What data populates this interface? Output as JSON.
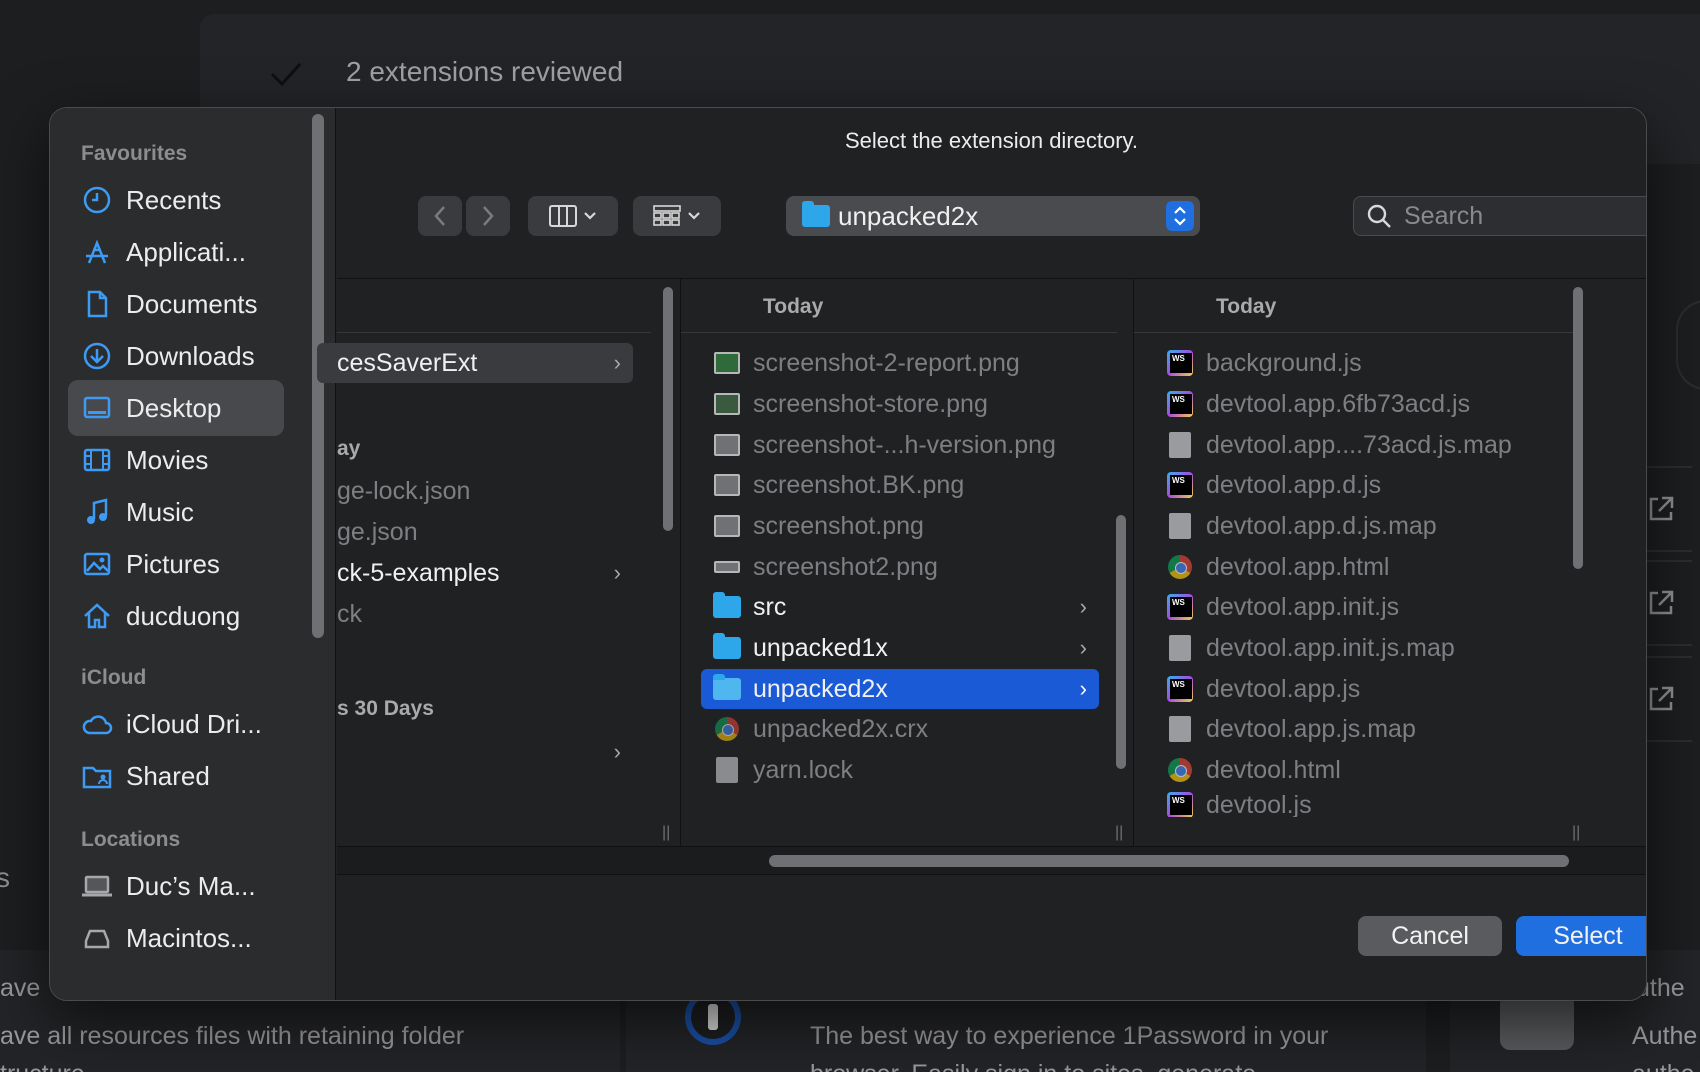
{
  "background": {
    "reviewed_text": "2 extensions reviewed",
    "left_fragment": "s",
    "card_left_title_fragment": "ave",
    "card_left_desc_fragment": "ave all resources files with retaining folder",
    "card_left_desc_line2_fragment": "tructure",
    "card_mid_desc_line1": "The best way to experience 1Password in your",
    "card_mid_desc_line2": "browser. Easily sign in to sites, generate",
    "card_right_title_fragment": "uthe",
    "card_right_desc_fragment": "Authe",
    "card_right_desc_line2_fragment": "authe"
  },
  "dialog": {
    "title": "Select the extension directory.",
    "path_popup_label": "unpacked2x",
    "search_placeholder": "Search",
    "cancel_label": "Cancel",
    "select_label": "Select"
  },
  "sidebar": {
    "sections": [
      {
        "header": "Favourites",
        "items": [
          {
            "label": "Recents",
            "icon": "clock-icon"
          },
          {
            "label": "Applicati...",
            "icon": "applications-icon"
          },
          {
            "label": "Documents",
            "icon": "document-icon"
          },
          {
            "label": "Downloads",
            "icon": "download-icon"
          },
          {
            "label": "Desktop",
            "icon": "desktop-icon",
            "selected": true
          },
          {
            "label": "Movies",
            "icon": "film-icon"
          },
          {
            "label": "Music",
            "icon": "music-note-icon"
          },
          {
            "label": "Pictures",
            "icon": "pictures-icon"
          },
          {
            "label": "ducduong",
            "icon": "home-icon"
          }
        ]
      },
      {
        "header": "iCloud",
        "items": [
          {
            "label": "iCloud Dri...",
            "icon": "cloud-icon"
          },
          {
            "label": "Shared",
            "icon": "shared-folder-icon"
          }
        ]
      },
      {
        "header": "Locations",
        "items": [
          {
            "label": "Duc’s Ma...",
            "icon": "laptop-icon"
          },
          {
            "label": "Macintos...",
            "icon": "disk-icon"
          }
        ]
      }
    ]
  },
  "column1": {
    "items": [
      {
        "label": "cesSaverExt",
        "selected": true,
        "chevron": true
      },
      {
        "label": "ay",
        "is_header": true
      },
      {
        "label": "ge-lock.json",
        "dim": true
      },
      {
        "label": "ge.json",
        "dim": true
      },
      {
        "label": "ck-5-examples",
        "chevron": true
      },
      {
        "label": "ck",
        "dim": true
      },
      {
        "label": "s 30 Days",
        "is_header": true
      },
      {
        "label": "",
        "chevron": true
      }
    ]
  },
  "column2": {
    "header": "Today",
    "items": [
      {
        "label": "screenshot-2-report.png",
        "icon": "image-file-icon",
        "dim": true
      },
      {
        "label": "screenshot-store.png",
        "icon": "image-file-icon",
        "dim": true
      },
      {
        "label": "screenshot-...h-version.png",
        "icon": "image-file-icon",
        "dim": true
      },
      {
        "label": "screenshot.BK.png",
        "icon": "image-file-icon",
        "dim": true
      },
      {
        "label": "screenshot.png",
        "icon": "image-file-icon",
        "dim": true
      },
      {
        "label": "screenshot2.png",
        "icon": "image-file-icon",
        "dim": true
      },
      {
        "label": "src",
        "icon": "folder-icon",
        "chevron": true
      },
      {
        "label": "unpacked1x",
        "icon": "folder-icon",
        "chevron": true
      },
      {
        "label": "unpacked2x",
        "icon": "folder-icon",
        "chevron": true,
        "selected": true
      },
      {
        "label": "unpacked2x.crx",
        "icon": "chrome-file-icon",
        "dim": true
      },
      {
        "label": "yarn.lock",
        "icon": "text-file-icon",
        "dim": true
      }
    ]
  },
  "column3": {
    "header": "Today",
    "items": [
      {
        "label": "background.js",
        "icon": "webstorm-file-icon"
      },
      {
        "label": "devtool.app.6fb73acd.js",
        "icon": "webstorm-file-icon"
      },
      {
        "label": "devtool.app....73acd.js.map",
        "icon": "generic-file-icon"
      },
      {
        "label": "devtool.app.d.js",
        "icon": "webstorm-file-icon"
      },
      {
        "label": "devtool.app.d.js.map",
        "icon": "generic-file-icon"
      },
      {
        "label": "devtool.app.html",
        "icon": "chrome-file-icon"
      },
      {
        "label": "devtool.app.init.js",
        "icon": "webstorm-file-icon"
      },
      {
        "label": "devtool.app.init.js.map",
        "icon": "generic-file-icon"
      },
      {
        "label": "devtool.app.js",
        "icon": "webstorm-file-icon"
      },
      {
        "label": "devtool.app.js.map",
        "icon": "generic-file-icon"
      },
      {
        "label": "devtool.html",
        "icon": "chrome-file-icon"
      },
      {
        "label": "devtool.js",
        "icon": "webstorm-file-icon"
      }
    ]
  },
  "colors": {
    "accent": "#1f6fe0",
    "selection": "#1a5ad6",
    "folder": "#2ea6ea"
  }
}
